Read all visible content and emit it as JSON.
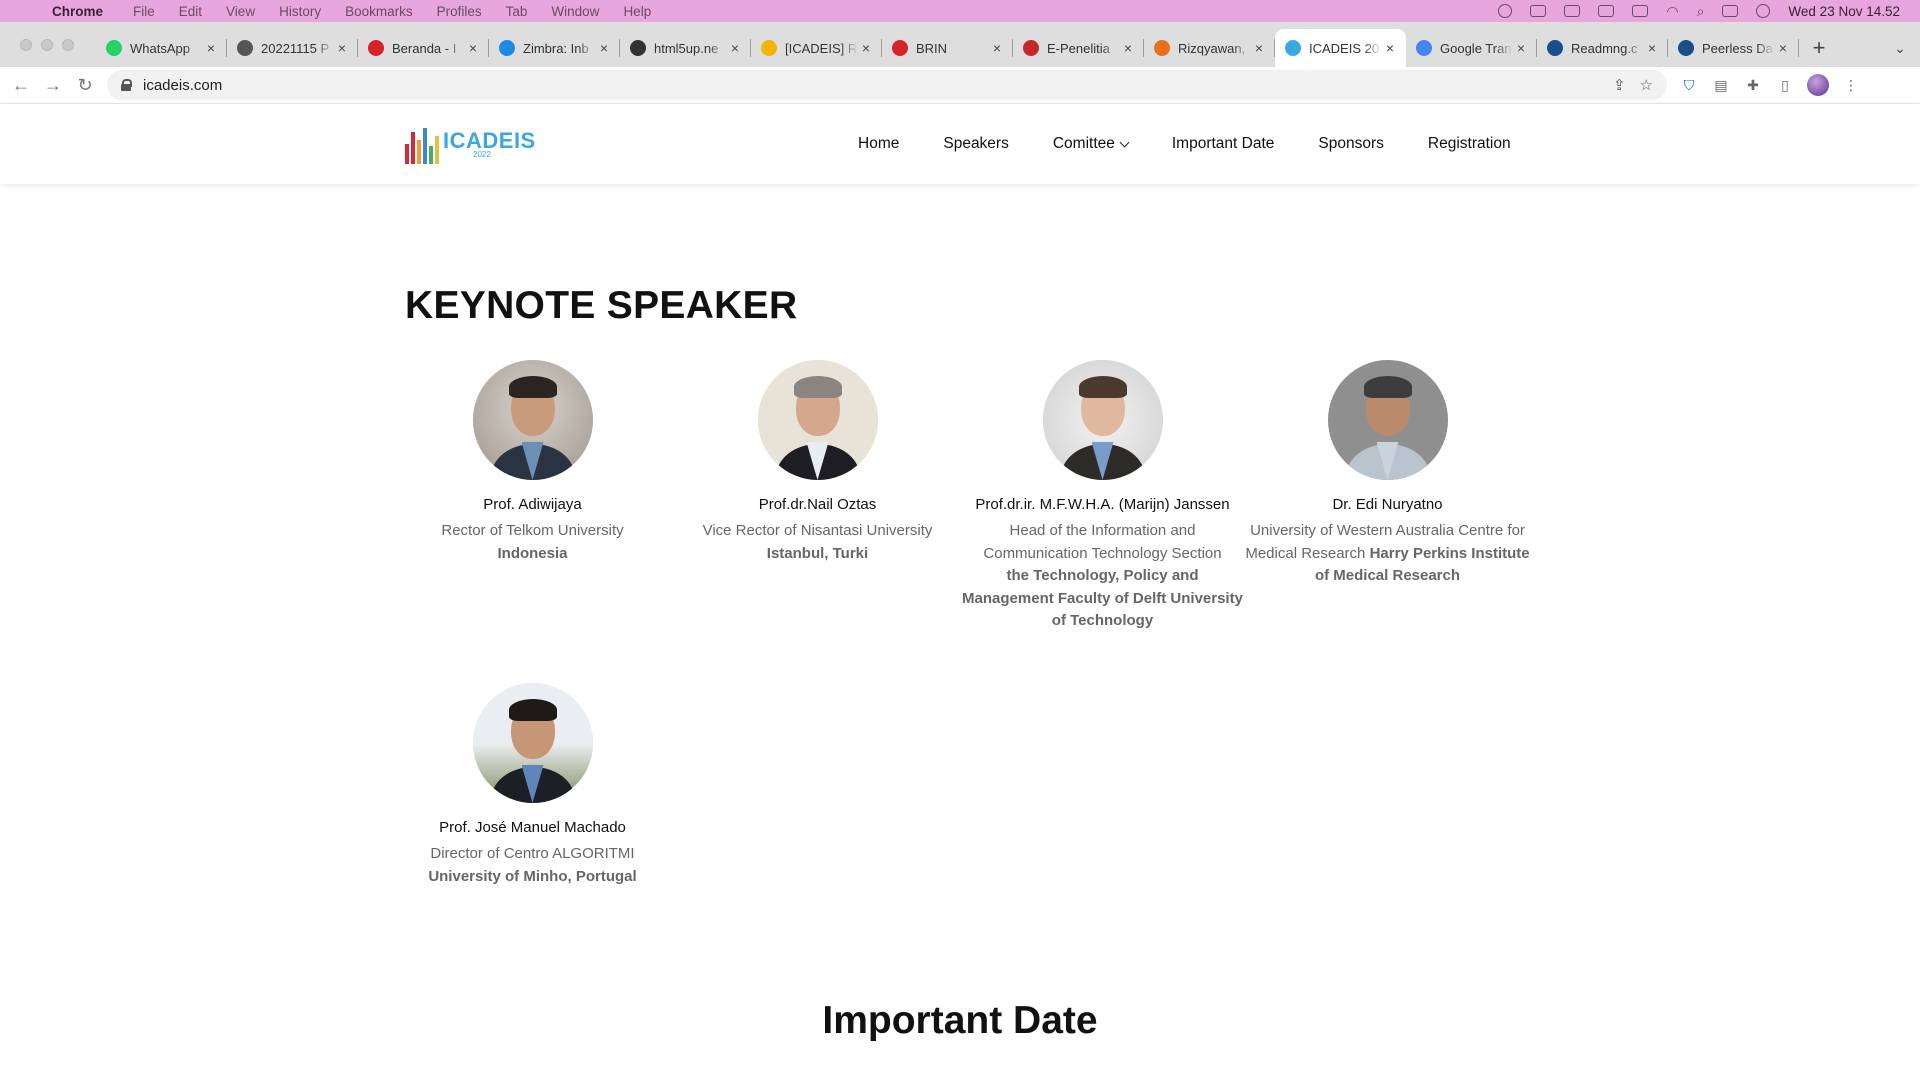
{
  "menubar": {
    "app": "Chrome",
    "items": [
      "File",
      "Edit",
      "View",
      "History",
      "Bookmarks",
      "Profiles",
      "Tab",
      "Window",
      "Help"
    ],
    "clock": "Wed 23 Nov  14.52"
  },
  "tabs": [
    {
      "title": "WhatsApp",
      "icon": "whatsapp-icon",
      "color": "#25d366",
      "glyph": "✆"
    },
    {
      "title": "20221115 P",
      "icon": "globe-icon",
      "color": "#555555",
      "glyph": "◍"
    },
    {
      "title": "Beranda - I",
      "icon": "beranda-icon",
      "color": "#d8232a",
      "glyph": "✳"
    },
    {
      "title": "Zimbra: Inb",
      "icon": "zimbra-icon",
      "color": "#1e88e5",
      "glyph": "Z"
    },
    {
      "title": "html5up.ne",
      "icon": "html5up-icon",
      "color": "#333333",
      "glyph": "◐"
    },
    {
      "title": "[ICADEIS] R",
      "icon": "slides-icon",
      "color": "#f4b400",
      "glyph": "▭"
    },
    {
      "title": "BRIN",
      "icon": "brin-icon",
      "color": "#d8232a",
      "glyph": "✳"
    },
    {
      "title": "E-Penelitia",
      "icon": "epenelitian-icon",
      "color": "#c62828",
      "glyph": "▲"
    },
    {
      "title": "Rizqyawan,",
      "icon": "scopus-icon",
      "color": "#e9711c",
      "glyph": "SC"
    },
    {
      "title": "ICADEIS 20",
      "icon": "icadeis-icon",
      "color": "#3aa7e0",
      "glyph": "▮"
    },
    {
      "title": "Google Tran",
      "icon": "google-translate-icon",
      "color": "#4285f4",
      "glyph": "G"
    },
    {
      "title": "Readmng.c",
      "icon": "readmng-icon",
      "color": "#1a4f8b",
      "glyph": "RM"
    },
    {
      "title": "Peerless Da",
      "icon": "readmng-icon",
      "color": "#1a4f8b",
      "glyph": "RM"
    }
  ],
  "active_tab_index": 9,
  "address": {
    "url": "icadeis.com"
  },
  "site": {
    "logo": {
      "name": "ICADEIS",
      "year": "2022"
    },
    "nav": [
      "Home",
      "Speakers",
      "Comittee",
      "Important Date",
      "Sponsors",
      "Registration"
    ],
    "section_title": "KEYNOTE SPEAKER",
    "speakers": [
      {
        "name": "Prof. Adiwijaya",
        "role": "Rector of Telkom University",
        "role_bold": "",
        "institution": "Indonesia"
      },
      {
        "name": "Prof.dr.Nail Oztas",
        "role": "Vice Rector of Nisantasi University",
        "role_bold": "",
        "institution": "Istanbul, Turki"
      },
      {
        "name": "Prof.dr.ir. M.F.W.H.A. (Marijn) Janssen",
        "role": "Head of the Information and Communication Technology Section",
        "role_bold": "",
        "institution": "the Technology, Policy and Management Faculty of Delft University of Technology"
      },
      {
        "name": "Dr. Edi Nuryatno",
        "role": "University of Western Australia Centre for Medical Research",
        "role_bold": "Harry Perkins Institute of Medical Research",
        "institution": ""
      },
      {
        "name": "Prof. José Manuel Machado",
        "role": "Director of Centro ALGORITMI",
        "role_bold": "",
        "institution": "University of Minho, Portugal"
      }
    ],
    "next_section_title": "Important Date"
  }
}
